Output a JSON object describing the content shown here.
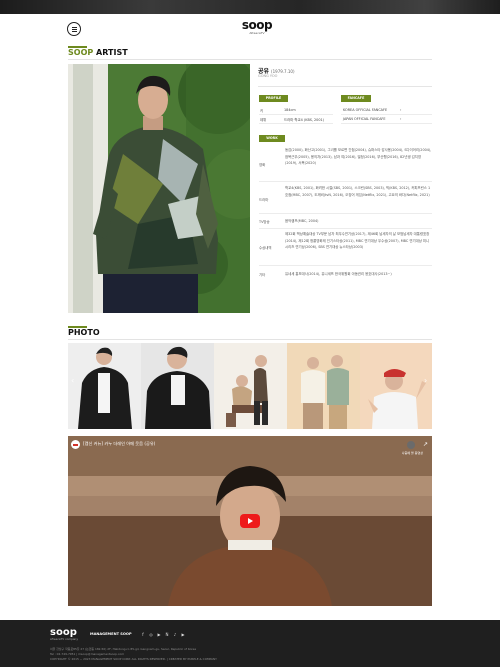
{
  "header": {
    "logo_main": "soop",
    "logo_sub": "AfreecaTV"
  },
  "artist_section": {
    "title_accent": "SOOP",
    "title_rest": " ARTIST"
  },
  "artist": {
    "name_ko": "공유",
    "birth": "(1979.7.10)",
    "name_en": "GONG YOO",
    "profile_tag": "PROFILE",
    "fancafe_tag": "FANCAFE",
    "profile_rows": [
      {
        "key": "키",
        "value": "184cm"
      },
      {
        "key": "데뷔",
        "value": "드라마 학교4 (KBS, 2001)"
      }
    ],
    "fancafe_rows": [
      {
        "label": "KOREA OFFICIAL FANCAFE",
        "arrow": "›"
      },
      {
        "label": "JAPAN OFFICIAL FANCAFE",
        "arrow": "›"
      }
    ],
    "work_tag": "WORK",
    "work_rows": [
      {
        "label": "영화",
        "text": "동감(2000), 화산고(2001), 그녀를 모르면 간첩(2004), 슈퍼스타 감사용(2004), S다이어리(2004), 잠복근무(2005), 용의자(2013), 남과 여(2016), 밀정(2016), 부산행(2016), 82년생 김지영(2019), 서복(2020)"
      },
      {
        "label": "드라마",
        "text": "학교4(KBS, 2001), 화려한 시절(SBS, 2001), 스크린(SBS, 2003), 빅(KBS, 2012), 커피프린스 1호점(MBC, 2007), 도깨비(tvN, 2016), 오징어 게임(Netflix, 2021), 고요의 바다(Netflix, 2021)"
      },
      {
        "label": "TV방송",
        "text": "음악캠프(MBC, 2004)"
      },
      {
        "label": "수상내역",
        "text": "제32회 백상예술대상 TV부문 남자 최우수연기상(2017), 제46회 납세자의 날 모범납세자 대통령표창(2014), 제12회 청룡영화제 인기스타상(2011), MBC 연기대상 우수상(2007), MBC 연기대상 미니시리즈 연기상(2006), SBS 연기대상 뉴스타상(2003)"
      },
      {
        "label": "기타",
        "text": "유네세 홍보대사(2014), 유니세프 한국위원회 아동권리 옹호대사(2013~)"
      }
    ]
  },
  "photo_section": {
    "title": "PHOTO",
    "prev_arrow": "‹",
    "next_arrow": "›"
  },
  "video": {
    "title": "[캠신 커뉴] 카누 더레인 아메 웃음 (공유)",
    "watch_later": "나중에 볼 동영상"
  },
  "footer": {
    "logo": "soop",
    "logo_sub": "AfreecaTV company",
    "mgmt": "MANAGEMENT SOOP",
    "social_icons": [
      "f",
      "◎",
      "▶",
      "N",
      "♪",
      "▶"
    ],
    "address": "서울 강남구 학동로85길 27 (논현동 182-50) 2F, Hakdong-ro 85-gil, Gangnam-gu, Seoul, Republic of Korea",
    "contact": "Tel : 02-749-7951 | msoop@managementsoop.com",
    "copyright": "COPYRIGHT © 2015 ~ 2023 MANAGEMENT SOOP CORP. ALL RIGHTS RESERVED. | CREATED BY PURPLE & COMPANY"
  },
  "colors": {
    "accent": "#6e8a1f",
    "footer_bg": "#1f1f1f",
    "play_red": "#ee1b1b"
  }
}
